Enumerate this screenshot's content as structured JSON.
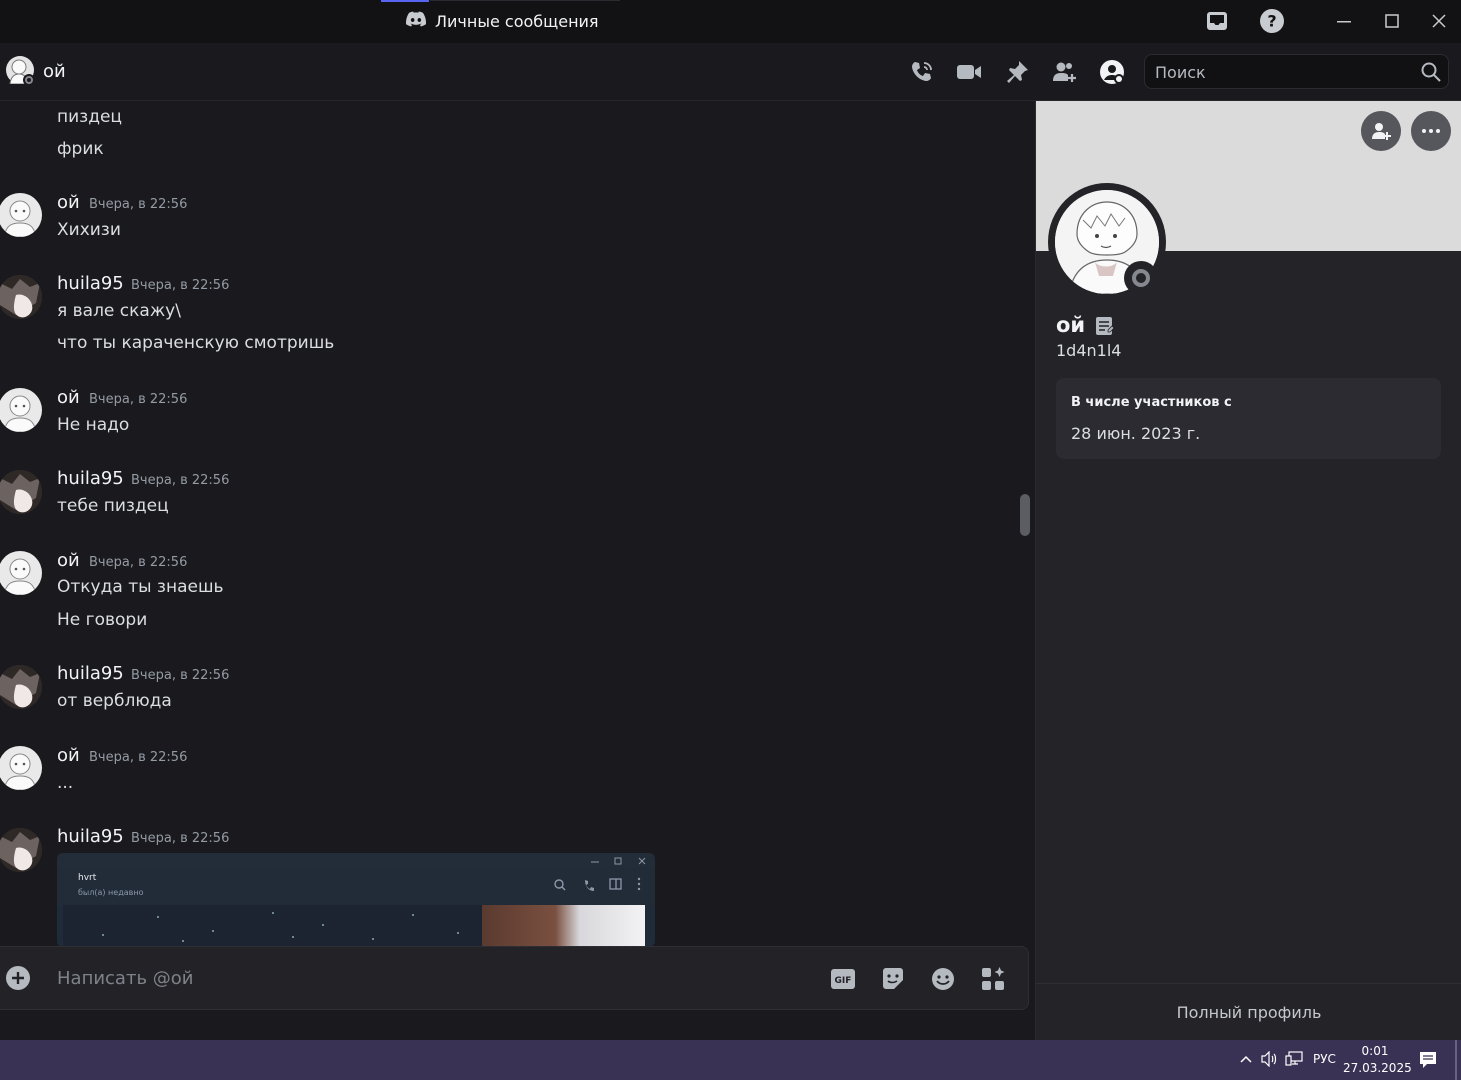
{
  "window": {
    "title": "Личные сообщения"
  },
  "header": {
    "name": "ой",
    "search_placeholder": "Поиск"
  },
  "messages": [
    {
      "kind": "text",
      "text": "пиздец"
    },
    {
      "kind": "text",
      "text": "фрик"
    },
    {
      "kind": "group",
      "author": "ой",
      "timestamp": "Вчера, в 22:56",
      "lines": [
        "Хихизи"
      ]
    },
    {
      "kind": "group",
      "author": "huila95",
      "timestamp": "Вчера, в 22:56",
      "lines": [
        "я вале скажу\\",
        "что ты караченскую смотришь"
      ]
    },
    {
      "kind": "group",
      "author": "ой",
      "timestamp": "Вчера, в 22:56",
      "lines": [
        "Не надо"
      ]
    },
    {
      "kind": "group",
      "author": "huila95",
      "timestamp": "Вчера, в 22:56",
      "lines": [
        "тебе пиздец"
      ]
    },
    {
      "kind": "group",
      "author": "ой",
      "timestamp": "Вчера, в 22:56",
      "lines": [
        "Откуда ты знаешь",
        "Не говори"
      ]
    },
    {
      "kind": "group",
      "author": "huila95",
      "timestamp": "Вчера, в 22:56",
      "lines": [
        "от верблюда"
      ]
    },
    {
      "kind": "group",
      "author": "ой",
      "timestamp": "Вчера, в 22:56",
      "lines": [
        "..."
      ]
    },
    {
      "kind": "group",
      "author": "huila95",
      "timestamp": "Вчера, в 22:56",
      "lines": []
    }
  ],
  "attachment": {
    "name": "hvrt",
    "status": "был(а) недавно"
  },
  "composer": {
    "placeholder": "Написать @ой",
    "gif_label": "GIF"
  },
  "profile": {
    "display_name": "ой",
    "username": "1d4n1l4",
    "member_since_label": "В числе участников с",
    "member_since_date": "28 июн. 2023 г.",
    "full_profile_label": "Полный профиль"
  },
  "taskbar": {
    "language": "РУС",
    "time": "0:01",
    "date": "27.03.2025"
  },
  "colors": {
    "background": "#1a1a1e",
    "panel": "#232328",
    "accent": "#5865f2",
    "taskbar": "#3a3254"
  }
}
